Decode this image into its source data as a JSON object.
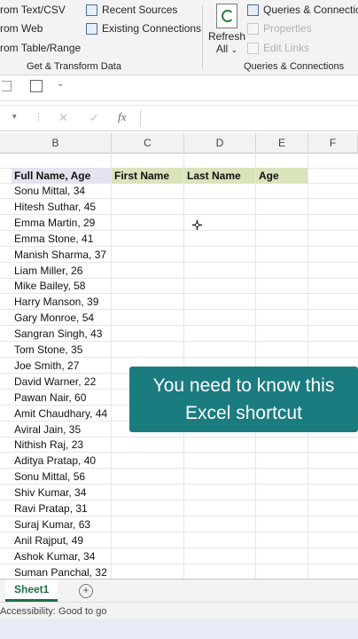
{
  "ribbon": {
    "get_transform": {
      "items": [
        "rom Text/CSV",
        "rom Web",
        "rom Table/Range"
      ],
      "items_col2": [
        "Recent Sources",
        "Existing Connections"
      ],
      "group_label": "Get & Transform Data"
    },
    "refresh": {
      "line1": "Refresh",
      "line2": "All",
      "caret": "⌄"
    },
    "queries": {
      "items": [
        "Queries & Connections",
        "Properties",
        "Edit Links"
      ],
      "group_label": "Queries & Connections"
    }
  },
  "formula_bar": {
    "fx": "fx",
    "cancel": "✕",
    "enter": "✓"
  },
  "columns": [
    "B",
    "C",
    "D",
    "E",
    "F"
  ],
  "table": {
    "headers": [
      "Full Name, Age",
      "First Name",
      "Last Name",
      "Age"
    ],
    "rows": [
      "Sonu Mittal, 34",
      "Hitesh Suthar, 45",
      "Emma Martin, 29",
      "Emma Stone, 41",
      "Manish Sharma, 37",
      "Liam Miller, 26",
      "Mike Bailey, 58",
      "Harry Manson, 39",
      "Gary Monroe, 54",
      "Sangran Singh, 43",
      "Tom Stone, 35",
      "Joe Smith, 27",
      "David Warner, 22",
      "Pawan Nair, 60",
      "Amit Chaudhary, 44",
      "Aviral Jain, 35",
      "Nithish Raj, 23",
      "Aditya Pratap, 40",
      "Sonu Mittal, 56",
      "Shiv Kumar, 34",
      "Ravi Pratap, 31",
      "Suraj Kumar, 63",
      "Anil Rajput, 49",
      "Ashok Kumar, 34",
      "Suman Panchal, 32"
    ]
  },
  "sheet_tab": "Sheet1",
  "add_sheet": "+",
  "status_text": "Accessibility: Good to go",
  "overlay": {
    "line1": "You need to know this",
    "line2": "Excel shortcut"
  },
  "colors": {
    "accent": "#1e7145",
    "overlay": "#1b7c80",
    "header_fill": "#d9e4bc"
  }
}
